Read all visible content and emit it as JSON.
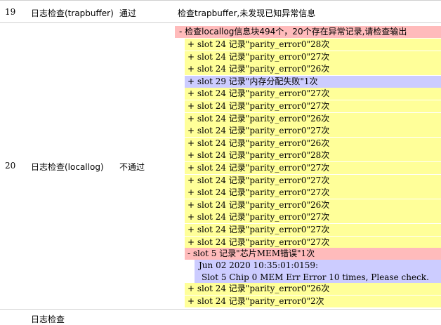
{
  "row19": {
    "num": "19",
    "item": "日志检查(trapbuffer)",
    "status": "通过",
    "detail": "检查trapbuffer,未发现已知异常信息"
  },
  "row20": {
    "num": "20",
    "item": "日志检查(locallog)",
    "status": "不通过",
    "summary": "- 检查locallog信息块494个，20个存在异常记录,请检查输出",
    "records": [
      {
        "text": "+ slot 24 记录\"parity_error0\"28次",
        "color": "yellow"
      },
      {
        "text": "+ slot 24 记录\"parity_error0\"27次",
        "color": "yellow"
      },
      {
        "text": "+ slot 24 记录\"parity_error0\"26次",
        "color": "yellow"
      },
      {
        "text": "+ slot 29 记录\"内存分配失败\"1次",
        "color": "lavender"
      },
      {
        "text": "+ slot 24 记录\"parity_error0\"27次",
        "color": "yellow"
      },
      {
        "text": "+ slot 24 记录\"parity_error0\"27次",
        "color": "yellow"
      },
      {
        "text": "+ slot 24 记录\"parity_error0\"26次",
        "color": "yellow"
      },
      {
        "text": "+ slot 24 记录\"parity_error0\"27次",
        "color": "yellow"
      },
      {
        "text": "+ slot 24 记录\"parity_error0\"26次",
        "color": "yellow"
      },
      {
        "text": "+ slot 24 记录\"parity_error0\"28次",
        "color": "yellow"
      },
      {
        "text": "+ slot 24 记录\"parity_error0\"27次",
        "color": "yellow"
      },
      {
        "text": "+ slot 24 记录\"parity_error0\"27次",
        "color": "yellow"
      },
      {
        "text": "+ slot 24 记录\"parity_error0\"27次",
        "color": "yellow"
      },
      {
        "text": "+ slot 24 记录\"parity_error0\"26次",
        "color": "yellow"
      },
      {
        "text": "+ slot 24 记录\"parity_error0\"27次",
        "color": "yellow"
      },
      {
        "text": "+ slot 24 记录\"parity_error0\"27次",
        "color": "yellow"
      },
      {
        "text": "+ slot 24 记录\"parity_error0\"27次",
        "color": "yellow"
      }
    ],
    "expanded": {
      "text": "- slot 5 记录\"芯片MEM错误\"1次",
      "detail_line1": "Jun 02 2020 10:35:01:0159:",
      "detail_line2": "Slot 5 Chip 0  MEM Err Error 10 times, Please check."
    },
    "tail_records": [
      {
        "text": "+ slot 24 记录\"parity_error0\"26次",
        "color": "yellow"
      },
      {
        "text": "+ slot 24 记录\"parity_error0\"2次",
        "color": "yellow"
      }
    ]
  },
  "row21": {
    "item_partial": "日志检查"
  },
  "colors": {
    "yellow": "#ffff99",
    "pink": "#ffbbbb",
    "lavender": "#ccccff"
  }
}
